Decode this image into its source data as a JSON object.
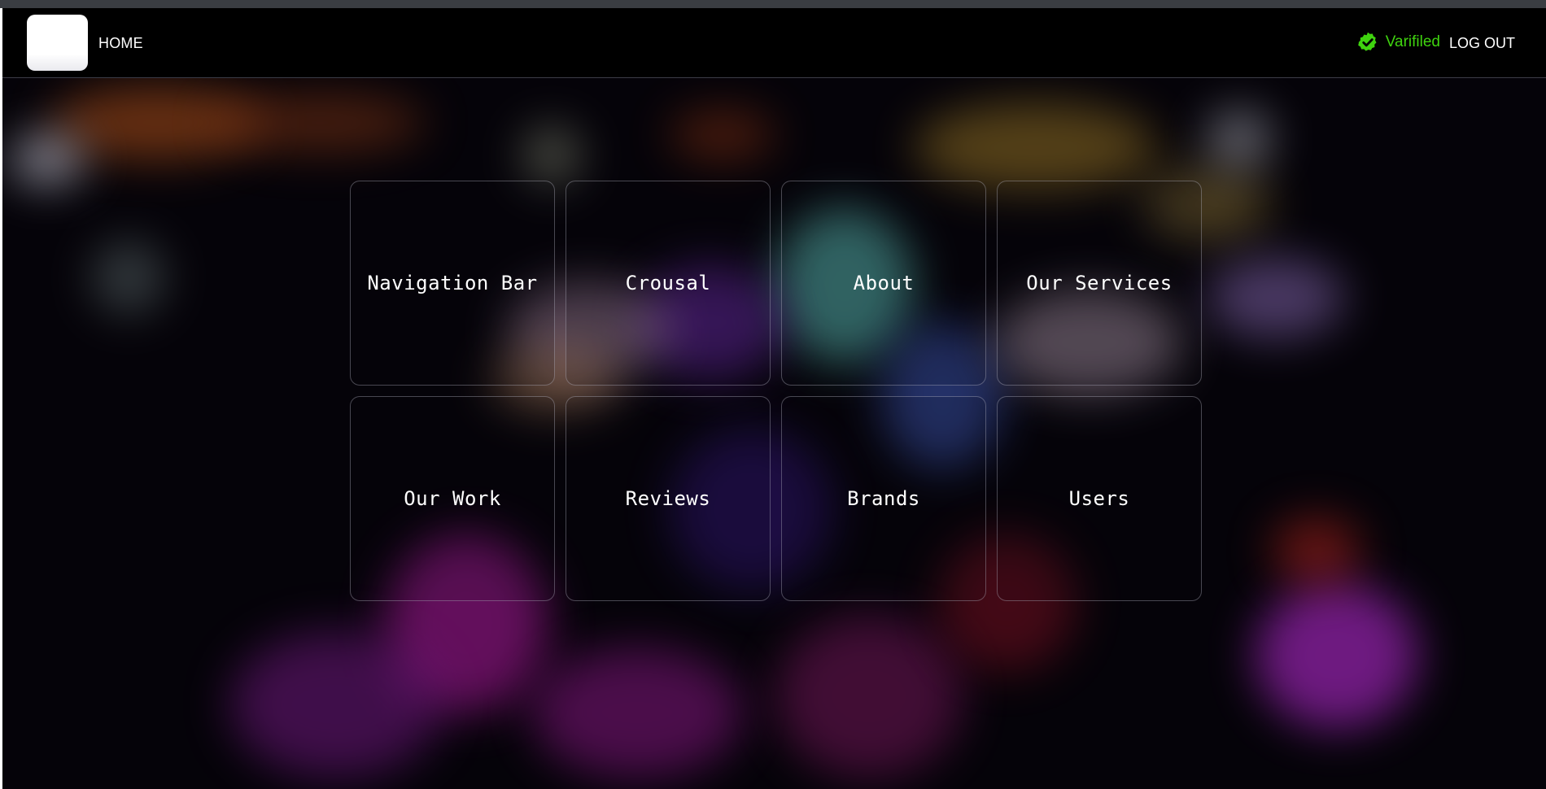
{
  "header": {
    "home_label": "HOME",
    "verified_label": "Varifiled",
    "logout_label": "LOG OUT",
    "verified_color": "#3fd30f"
  },
  "sections": [
    {
      "label": "Navigation Bar"
    },
    {
      "label": "Crousal"
    },
    {
      "label": "About"
    },
    {
      "label": "Our Services"
    },
    {
      "label": "Our Work"
    },
    {
      "label": "Reviews"
    },
    {
      "label": "Brands"
    },
    {
      "label": "Users"
    }
  ],
  "icons": {
    "verified": "verified-badge-icon"
  }
}
